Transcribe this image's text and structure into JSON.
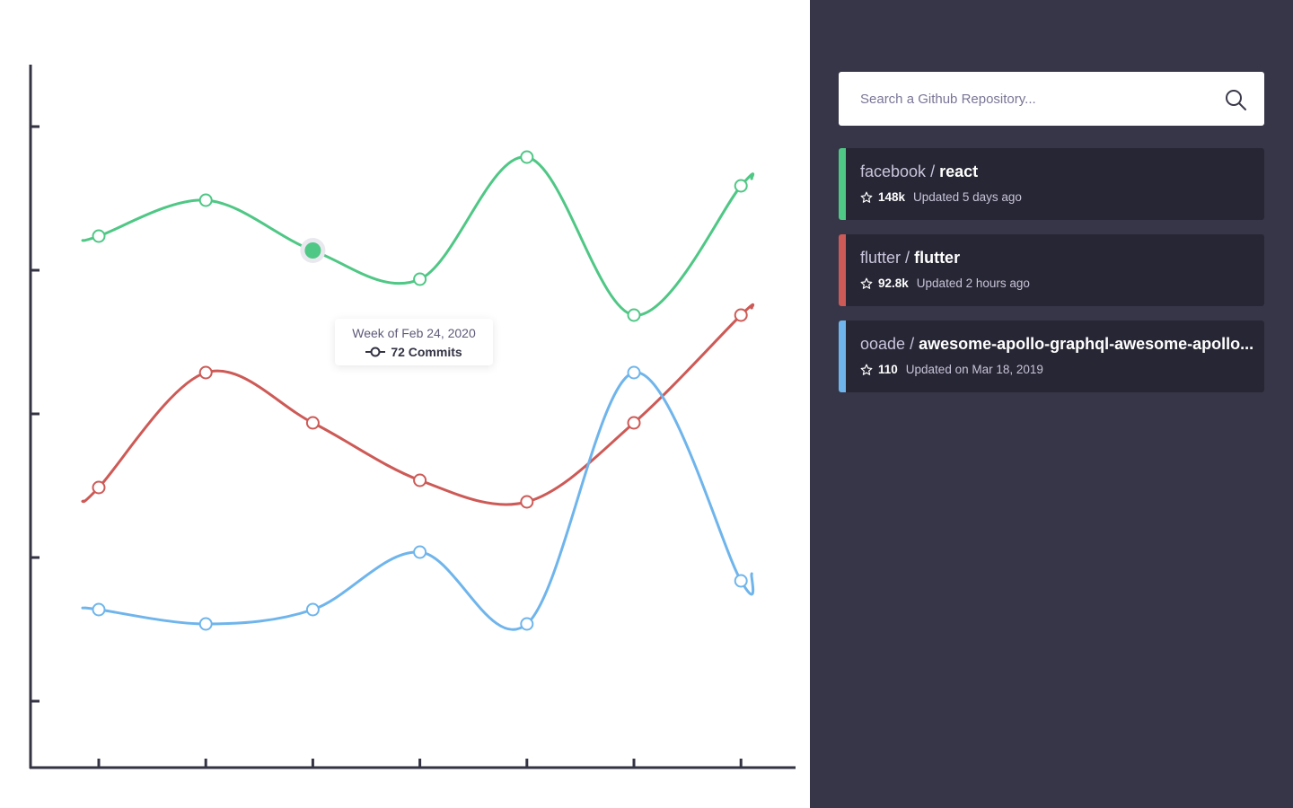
{
  "search": {
    "placeholder": "Search a Github Repository..."
  },
  "repos": [
    {
      "owner": "facebook",
      "name": "react",
      "stars": "148k",
      "updated": "Updated 5 days ago",
      "color": "#4fc785"
    },
    {
      "owner": "flutter",
      "name": "flutter",
      "stars": "92.8k",
      "updated": "Updated 2 hours ago",
      "color": "#cd5a56"
    },
    {
      "owner": "ooade",
      "name": "awesome-apollo-graphql-awesome-apollo...",
      "stars": "110",
      "updated": "Updated on Mar 18, 2019",
      "color": "#6fb5ec"
    }
  ],
  "tooltip": {
    "date": "Week of Feb 24, 2020",
    "value": "72 Commits"
  },
  "chart_data": {
    "type": "line",
    "x": [
      1,
      2,
      3,
      4,
      5,
      6,
      7
    ],
    "ylim": [
      0,
      100
    ],
    "grid": false,
    "series": [
      {
        "name": "react",
        "color": "#4fc785",
        "values": [
          74,
          79,
          72,
          68,
          85,
          63,
          81
        ]
      },
      {
        "name": "flutter",
        "color": "#cd5a56",
        "values": [
          39,
          55,
          48,
          40,
          37,
          48,
          63
        ]
      },
      {
        "name": "awesome-apollo-graphql",
        "color": "#6fb5ec",
        "values": [
          22,
          20,
          22,
          30,
          20,
          55,
          26
        ]
      }
    ],
    "highlight": {
      "series": "react",
      "index": 2
    }
  }
}
